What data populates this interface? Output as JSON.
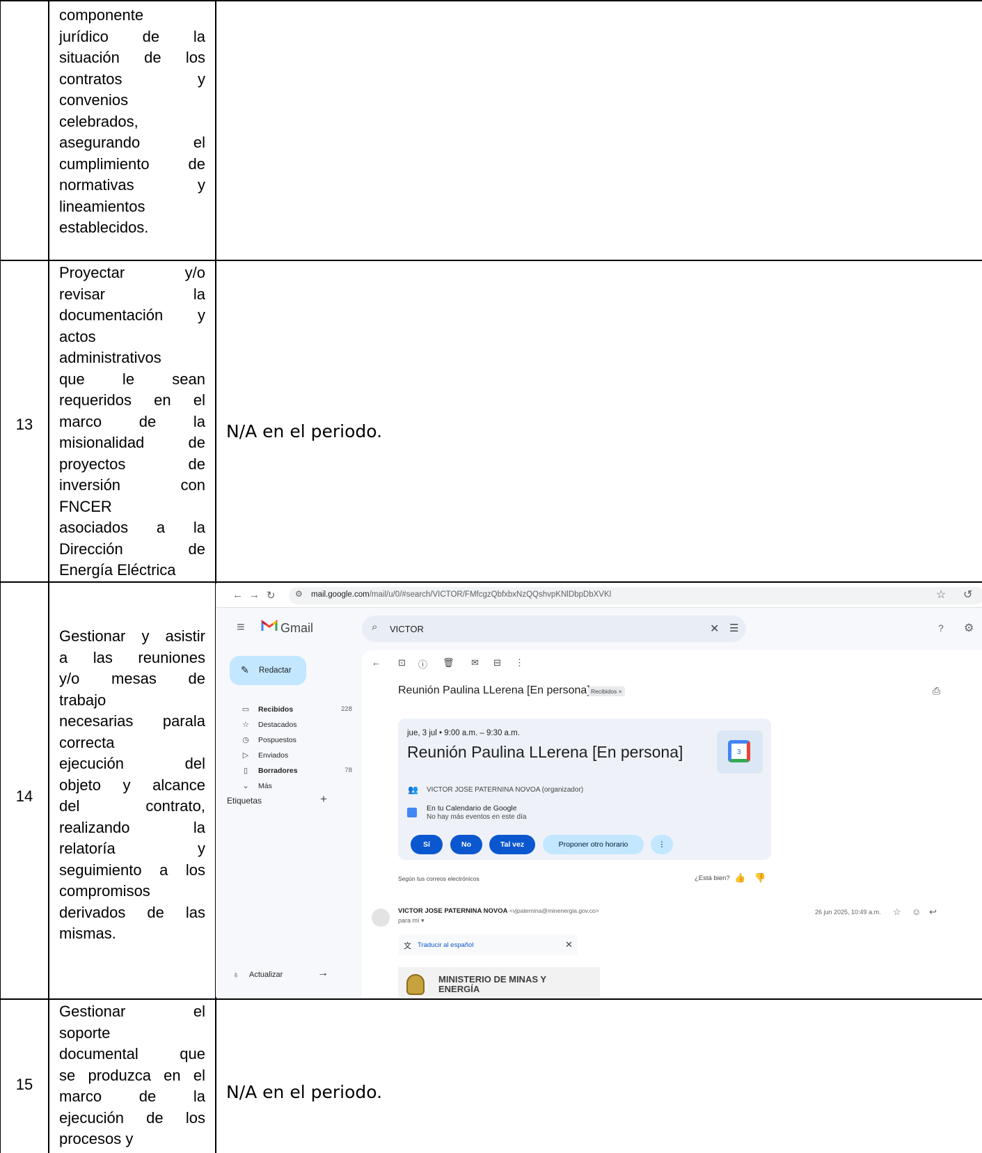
{
  "rows": [
    {
      "number": "",
      "activity_lines": [
        "componente",
        "jurídico de la",
        "situación de los",
        "contratos y",
        "convenios",
        "celebrados,",
        "asegurando el",
        "cumplimiento de",
        "normativas y",
        "lineamientos",
        "establecidos."
      ],
      "evidence": ""
    },
    {
      "number": "13",
      "activity_lines": [
        "Proyectar y/o",
        "revisar la",
        "documentación y",
        "actos",
        "administrativos",
        "que le sean",
        "requeridos en el",
        "marco de la",
        "misionalidad de",
        "proyectos de",
        "inversión con",
        "FNCER",
        "asociados a la",
        "Dirección de",
        "Energía Eléctrica"
      ],
      "evidence": "N/A  en el periodo."
    },
    {
      "number": "14",
      "activity_lines": [
        "Gestionar y asistir",
        "a las reuniones",
        "y/o mesas de",
        "trabajo",
        "necesarias parala",
        "correcta",
        "ejecución del",
        "objeto y alcance",
        "del contrato,",
        "realizando la",
        "relatoría y",
        "seguimiento a los",
        "compromisos",
        "derivados de las",
        "mismas."
      ],
      "evidence": ""
    },
    {
      "number": "15",
      "activity_lines": [
        "Gestionar el",
        "soporte",
        "documental que",
        "se produzca en el",
        "marco de la",
        "ejecución de los",
        "procesos y"
      ],
      "evidence": "N/A  en el periodo."
    }
  ],
  "screenshot": {
    "browser": {
      "url_host": "mail.google.com",
      "url_path": "/mail/u/0/#search/VICTOR/FMfcgzQbfxbxNzQQshvpKNlDbpDbXVKl",
      "icons": [
        "back-arrow-icon",
        "forward-arrow-icon",
        "reload-icon",
        "site-settings-icon",
        "bookmark-star-icon",
        "history-icon"
      ]
    },
    "app_name": "Gmail",
    "search_query": "VICTOR",
    "compose_label": "Redactar",
    "sidebar": [
      {
        "label": "Recibidos",
        "count": "228",
        "icon": "inbox-icon"
      },
      {
        "label": "Destacados",
        "count": "",
        "icon": "star-icon"
      },
      {
        "label": "Pospuestos",
        "count": "",
        "icon": "clock-icon"
      },
      {
        "label": "Enviados",
        "count": "",
        "icon": "send-icon"
      },
      {
        "label": "Borradores",
        "count": "78",
        "icon": "draft-icon"
      },
      {
        "label": "Más",
        "count": "",
        "icon": "chevron-down-icon"
      }
    ],
    "labels_heading": "Etiquetas",
    "update_label": "Actualizar",
    "email": {
      "subject": "Reunión Paulina LLerena [En persona]",
      "tag": "Recibidos ×",
      "event_time": "jue, 3 jul • 9:00 a.m. – 9:30 a.m.",
      "event_title": "Reunión Paulina LLerena [En persona]",
      "calendar_day": "3",
      "organizer_name": "VICTOR JOSE PATERNINA NOVOA",
      "organizer_role": "(organizador)",
      "calendar_line1": "En tu Calendario de Google",
      "calendar_line2": "No hay más eventos en este día",
      "rsvp": {
        "yes": "Sí",
        "no": "No",
        "maybe": "Tal vez",
        "propose": "Proponer otro horario"
      },
      "based_on": "Según tus correos electrónicos",
      "feedback_question": "¿Está bien?",
      "sender_name": "VICTOR JOSE PATERNINA NOVOA",
      "sender_email": "<vjpaternina@minenergia.gov.co>",
      "to": "para mí ▾",
      "date": "26 jun 2025, 10:49 a.m.",
      "translate": "Traducir al español",
      "org_line1": "MINISTERIO DE MINAS Y",
      "org_line2": "ENERGÍA"
    },
    "colors": {
      "accent": "#0b57d0",
      "compose": "#c2e7ff",
      "background": "#f6f8fc"
    }
  }
}
